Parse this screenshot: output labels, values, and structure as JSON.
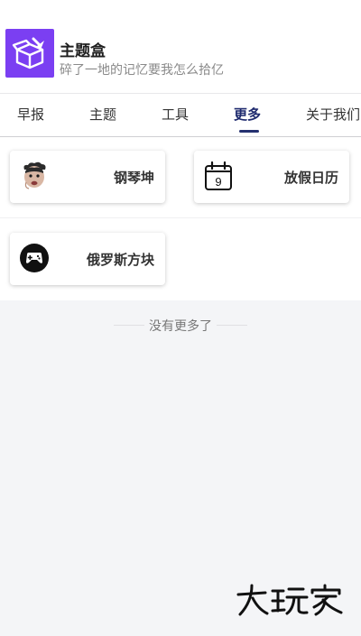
{
  "app": {
    "title": "主题盒",
    "subtitle": "碎了一地的记忆要我怎么拾亿",
    "brand_color": "#7b3ff2"
  },
  "tabs": [
    {
      "label": "早报",
      "active": false
    },
    {
      "label": "主题",
      "active": false
    },
    {
      "label": "工具",
      "active": false
    },
    {
      "label": "更多",
      "active": true
    },
    {
      "label": "关于我们",
      "active": false
    }
  ],
  "cards": [
    {
      "label": "钢琴坤",
      "icon": "cartoon-face-icon"
    },
    {
      "label": "放假日历",
      "icon": "calendar-icon",
      "icon_text": "9"
    },
    {
      "label": "俄罗斯方块",
      "icon": "gamepad-icon"
    }
  ],
  "footer": {
    "no_more_text": "没有更多了"
  },
  "watermark": {
    "text": "大玩家"
  }
}
